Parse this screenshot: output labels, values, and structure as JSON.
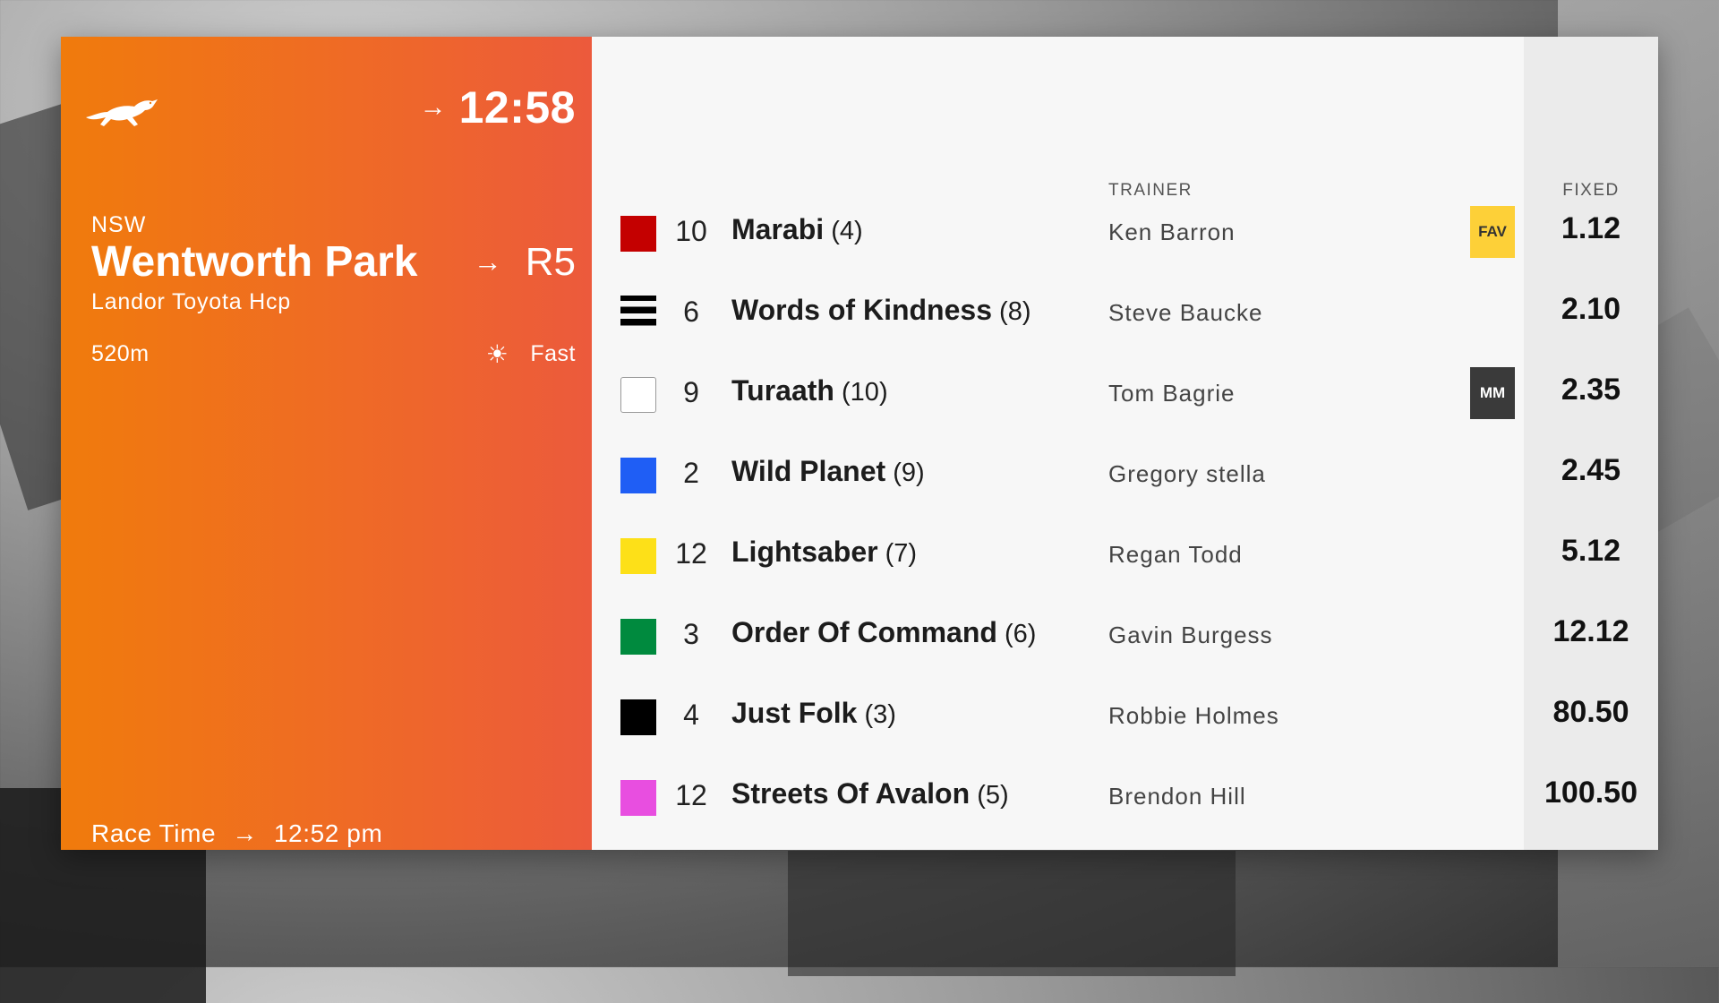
{
  "header": {
    "next_time": "12:58",
    "state": "NSW",
    "venue": "Wentworth Park",
    "race_number": "R5",
    "race_name": "Landor Toyota Hcp",
    "distance": "520m",
    "track_condition": "Fast",
    "race_time_label": "Race Time",
    "race_time": "12:52 pm"
  },
  "columns": {
    "trainer": "TRAINER",
    "fixed": "FIXED"
  },
  "runners": [
    {
      "silk_color": "#c40000",
      "number": "10",
      "name": "Marabi",
      "box": "(4)",
      "trainer": "Ken Barron",
      "badge": "FAV",
      "odds": "1.12"
    },
    {
      "silk_color": "stripes",
      "number": "6",
      "name": "Words of Kindness",
      "box": "(8)",
      "trainer": "Steve Baucke",
      "badge": "",
      "odds": "2.10"
    },
    {
      "silk_color": "#ffffff",
      "number": "9",
      "name": "Turaath",
      "box": "(10)",
      "trainer": "Tom Bagrie",
      "badge": "MM",
      "odds": "2.35"
    },
    {
      "silk_color": "#1f5ef5",
      "number": "2",
      "name": "Wild Planet",
      "box": "(9)",
      "trainer": "Gregory stella",
      "badge": "",
      "odds": "2.45"
    },
    {
      "silk_color": "#fde018",
      "number": "12",
      "name": "Lightsaber",
      "box": "(7)",
      "trainer": "Regan Todd",
      "badge": "",
      "odds": "5.12"
    },
    {
      "silk_color": "#008a3e",
      "number": "3",
      "name": "Order Of Command",
      "box": "(6)",
      "trainer": "Gavin Burgess",
      "badge": "",
      "odds": "12.12"
    },
    {
      "silk_color": "#000000",
      "number": "4",
      "name": "Just Folk",
      "box": "(3)",
      "trainer": "Robbie Holmes",
      "badge": "",
      "odds": "80.50"
    },
    {
      "silk_color": "#e84ee0",
      "number": "12",
      "name": "Streets Of Avalon",
      "box": "(5)",
      "trainer": "Brendon Hill",
      "badge": "",
      "odds": "100.50"
    }
  ],
  "icons": {
    "logo": "greyhound-icon",
    "arrow": "arrow-right-icon",
    "weather": "sun-icon"
  },
  "colors": {
    "panel_start": "#f07b0c",
    "panel_end": "#ec5a3c",
    "fav_badge": "#fdd038",
    "mm_badge": "#3a3a3a"
  }
}
